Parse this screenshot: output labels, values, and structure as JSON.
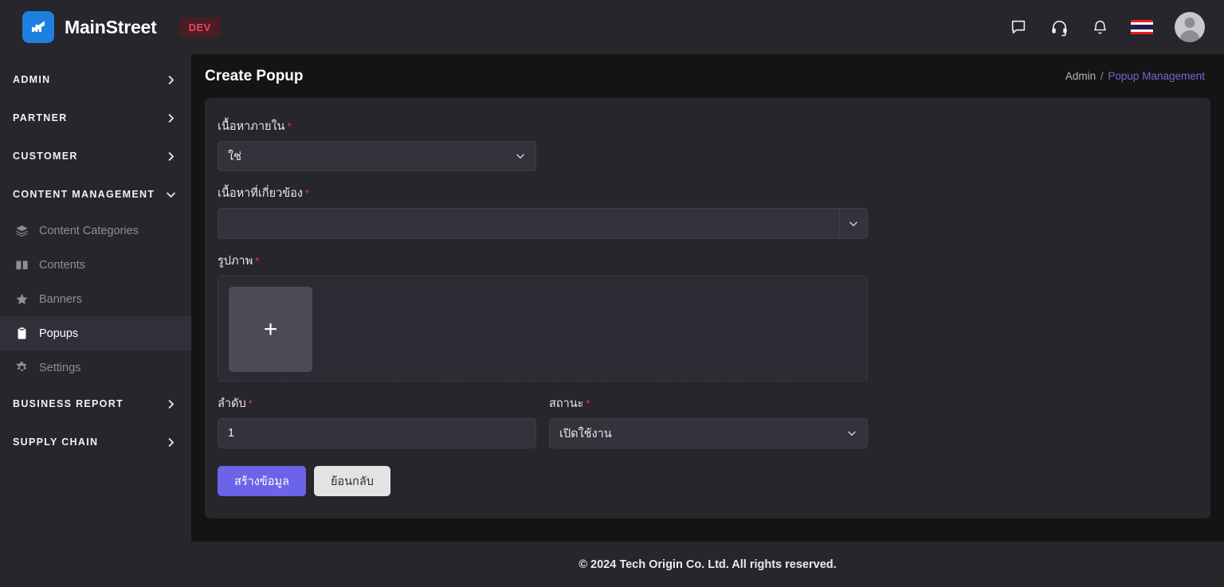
{
  "topbar": {
    "brand_name": "MainStreet",
    "env_badge": "DEV",
    "logo_icon": "chart-arrow-logo-icon",
    "icons": [
      {
        "name": "chat-icon",
        "title": "Messages"
      },
      {
        "name": "headset-icon",
        "title": "Support"
      },
      {
        "name": "bell-icon",
        "title": "Notifications"
      }
    ],
    "language_flag": "thailand-flag-icon",
    "avatar": "user-avatar"
  },
  "sidebar": {
    "groups": [
      {
        "label": "ADMIN",
        "expanded": false,
        "chevron": "chevron-right-icon",
        "items": []
      },
      {
        "label": "PARTNER",
        "expanded": false,
        "chevron": "chevron-right-icon",
        "items": []
      },
      {
        "label": "CUSTOMER",
        "expanded": false,
        "chevron": "chevron-right-icon",
        "items": []
      },
      {
        "label": "CONTENT MANAGEMENT",
        "expanded": true,
        "chevron": "chevron-down-icon",
        "items": [
          {
            "label": "Content Categories",
            "icon": "layers-icon",
            "active": false
          },
          {
            "label": "Contents",
            "icon": "book-icon",
            "active": false
          },
          {
            "label": "Banners",
            "icon": "star-icon",
            "active": false
          },
          {
            "label": "Popups",
            "icon": "clipboard-icon",
            "active": true
          },
          {
            "label": "Settings",
            "icon": "gear-icon",
            "active": false
          }
        ]
      },
      {
        "label": "BUSINESS REPORT",
        "expanded": false,
        "chevron": "chevron-right-icon",
        "items": []
      },
      {
        "label": "SUPPLY CHAIN",
        "expanded": false,
        "chevron": "chevron-right-icon",
        "items": []
      }
    ]
  },
  "page": {
    "title": "Create Popup",
    "breadcrumb_root": "Admin",
    "breadcrumb_sep": "/",
    "breadcrumb_current": "Popup Management"
  },
  "form": {
    "internal_content": {
      "label": "เนื้อหาภายใน",
      "required_mark": "*",
      "value": "ใช่",
      "caret": "chevron-down-icon"
    },
    "related_content": {
      "label": "เนื้อหาที่เกี่ยวข้อง",
      "required_mark": "*",
      "value": "",
      "caret": "chevron-down-icon"
    },
    "image": {
      "label": "รูปภาพ",
      "required_mark": "*",
      "add_glyph": "+",
      "add_icon": "plus-icon"
    },
    "order": {
      "label": "ลำดับ",
      "required_mark": "*",
      "value": "1"
    },
    "status": {
      "label": "สถานะ",
      "required_mark": "*",
      "value": "เปิดใช้งาน",
      "caret": "chevron-down-icon"
    },
    "submit_label": "สร้างข้อมูล",
    "back_label": "ย้อนกลับ"
  },
  "footer": {
    "text": "© 2024 Tech Origin Co. Ltd. All rights reserved."
  },
  "colors": {
    "brand_blue": "#1d7fe0",
    "accent_purple": "#6b63e8",
    "danger_red": "#e8394a",
    "badge_red": "#f2415a",
    "surface": "#26262c",
    "background": "#141414",
    "input": "#33333c"
  }
}
